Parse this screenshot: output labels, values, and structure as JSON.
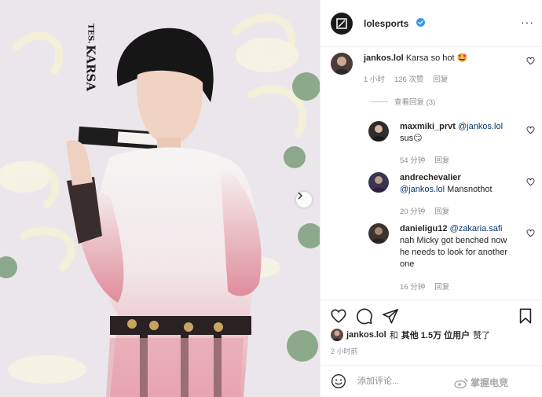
{
  "header": {
    "account_name": "lolesports",
    "verified_icon": "verified-badge-icon",
    "more_label": "···"
  },
  "photo": {
    "vertical_text_team": "TES.",
    "vertical_text_player": "KARSA"
  },
  "comments": [
    {
      "user": "jankos.lol",
      "text": "Karsa so hot 🤩",
      "time": "1 小时",
      "likes": "126 次赞",
      "reply_label": "回复",
      "view_replies": "查看回复 (3)"
    },
    {
      "user": "maxmiki_prvt",
      "mention": "@jankos.lol",
      "text": "sus😏",
      "time": "54 分钟",
      "reply_label": "回复"
    },
    {
      "user": "andrechevalier",
      "mention": "@jankos.lol",
      "text": "Mansnothot",
      "time": "20 分钟",
      "reply_label": "回复"
    },
    {
      "user": "danieligu12",
      "mention": "@zakaria.safi",
      "text": "nah Micky got benched now he needs to look for another one",
      "time": "16 分钟",
      "reply_label": "回复"
    }
  ],
  "likes": {
    "first_user": "jankos.lol",
    "joiner": "和",
    "others": "其他 1.5万 位用户",
    "suffix": "赞了"
  },
  "post_time": "2 小时前",
  "composer": {
    "placeholder": "添加评论...",
    "watermark": "掌握电竞"
  },
  "colors": {
    "accent_blue": "#3897f0",
    "text": "#262626",
    "muted": "#8e8e8e",
    "mention": "#00376b"
  }
}
